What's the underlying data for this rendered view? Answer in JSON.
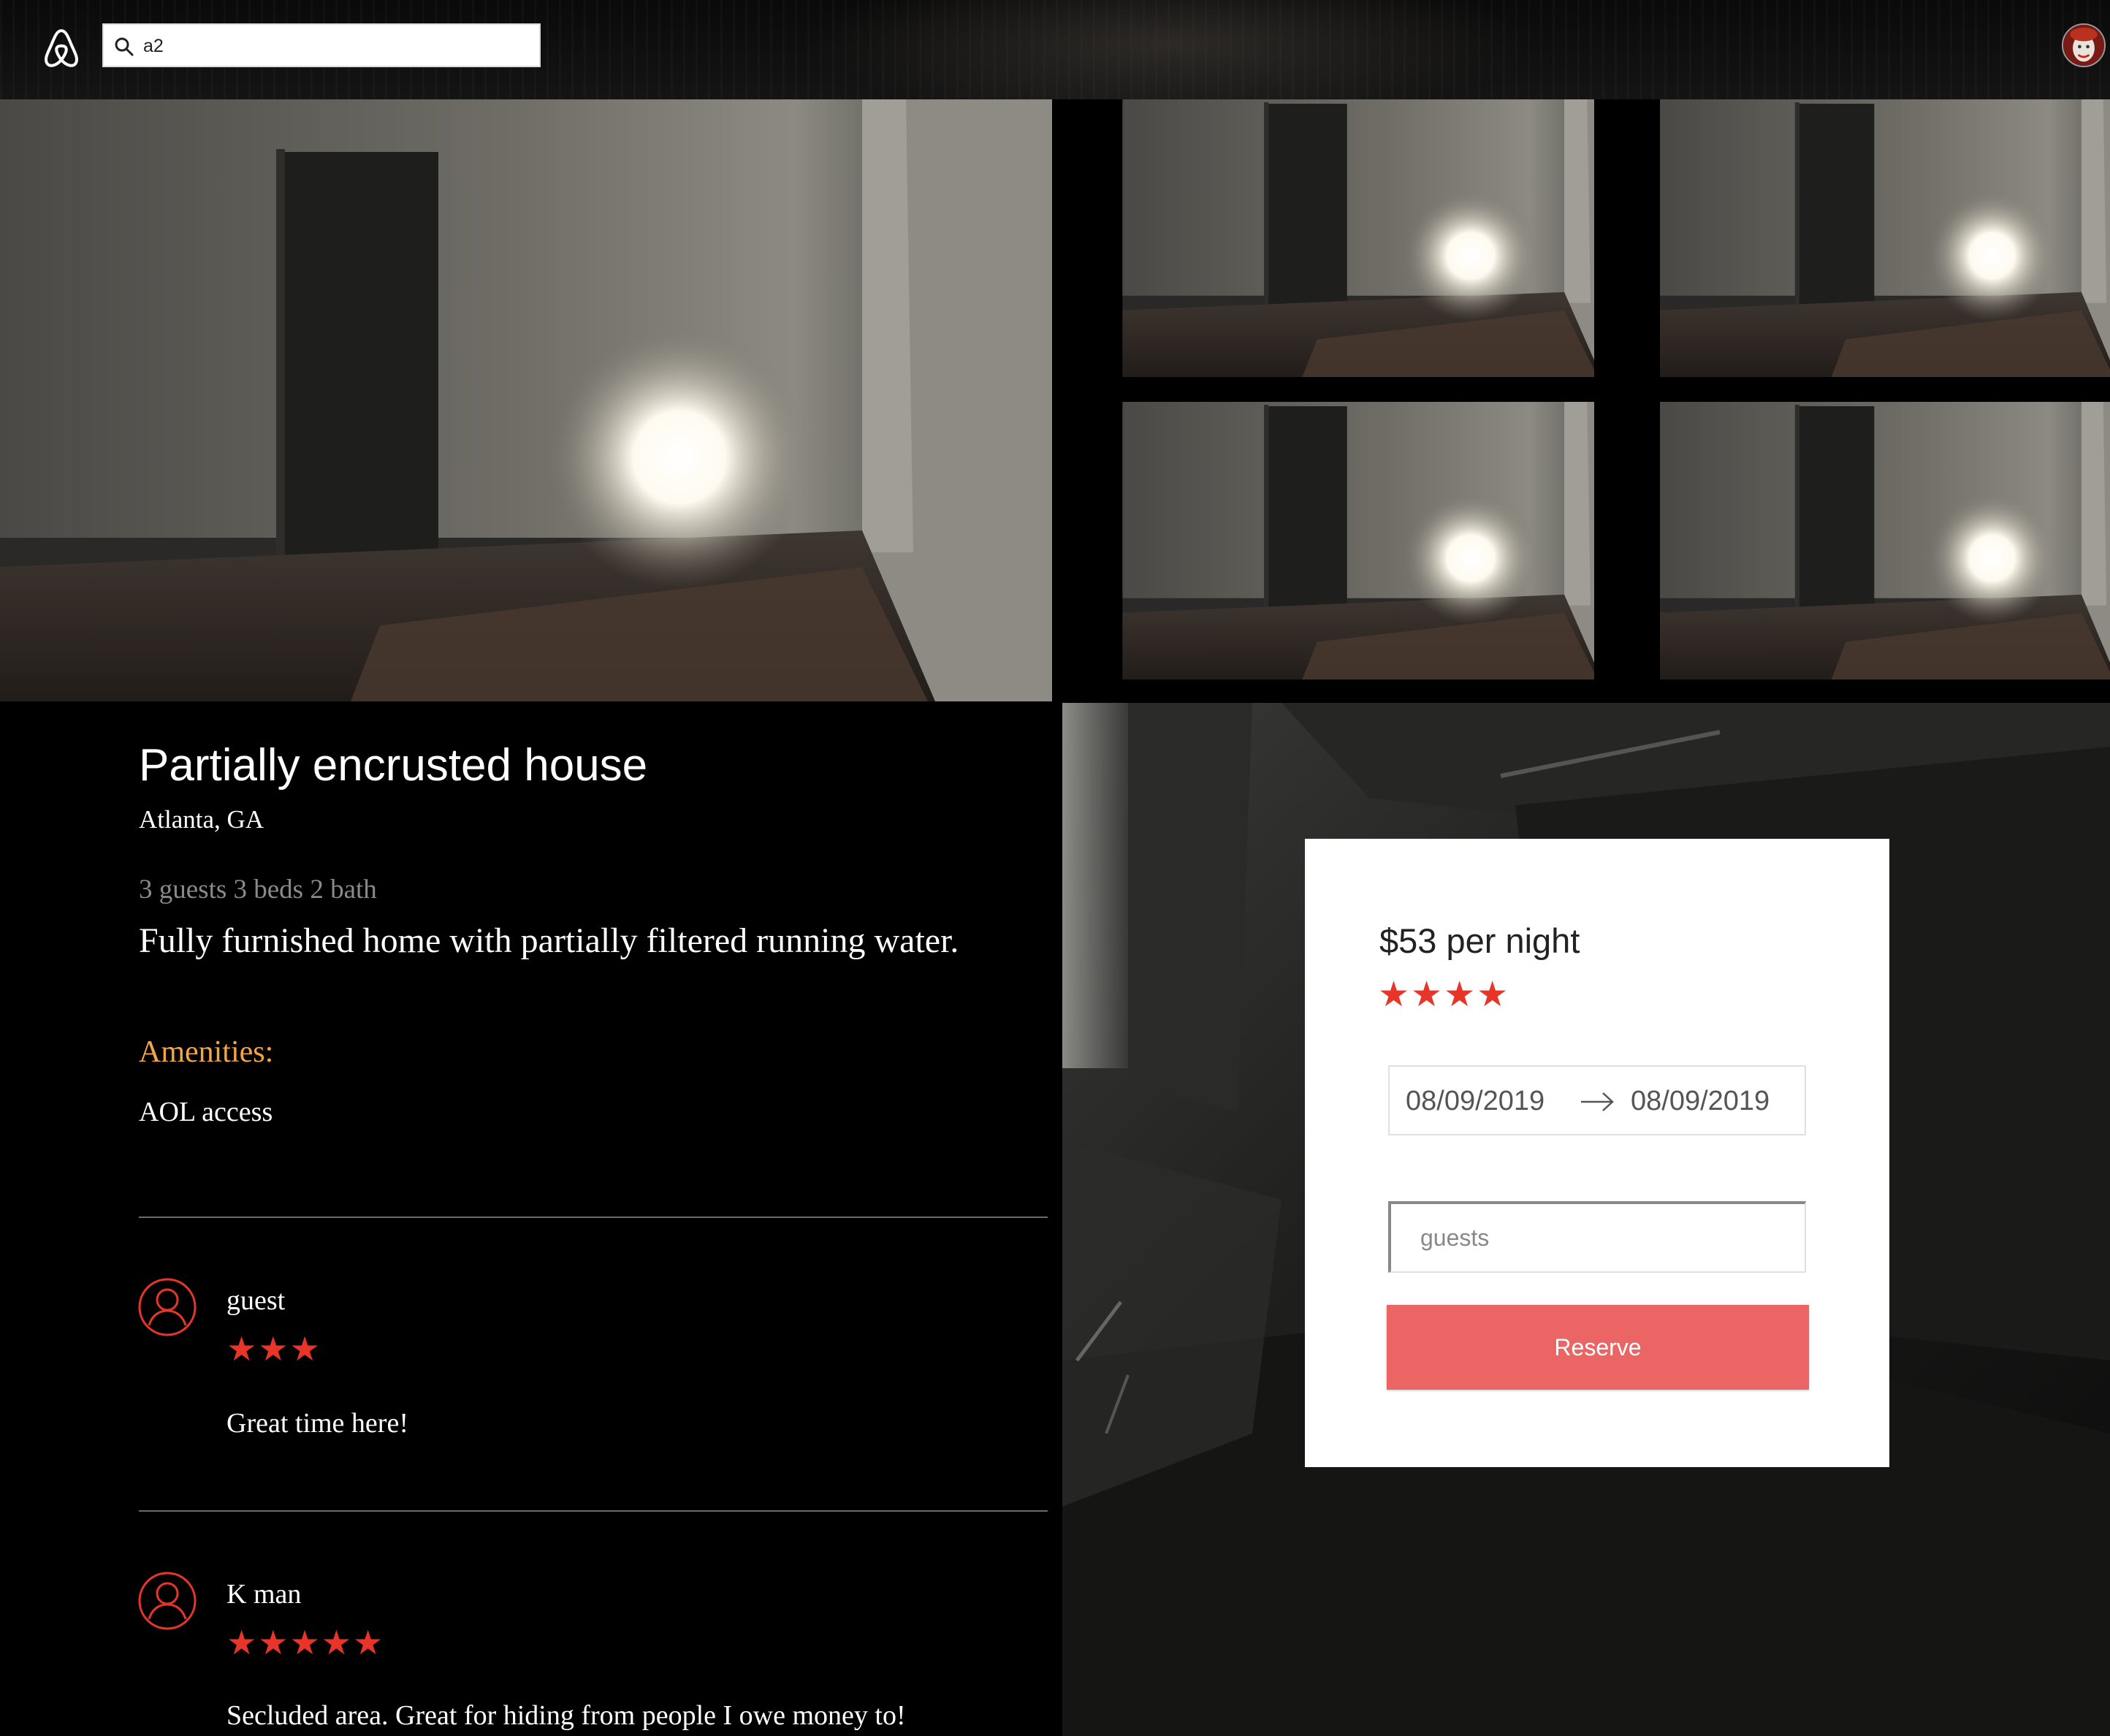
{
  "header": {
    "logo_icon": "airbnb-logo-icon",
    "search": {
      "value": "a2",
      "icon": "search-icon"
    },
    "avatar_icon": "clown-avatar"
  },
  "gallery": {
    "photos": [
      "dark-room-photo",
      "dark-room-photo",
      "dark-room-photo",
      "dark-room-photo",
      "dark-room-photo"
    ]
  },
  "listing": {
    "title": "Partially encrusted house",
    "location": "Atlanta, GA",
    "specs": "3 guests 3 beds 2 bath",
    "description": "Fully furnished home with partially filtered running water.",
    "amenities_heading": "Amenities:",
    "amenities": [
      "AOL access"
    ]
  },
  "reviews": [
    {
      "name": "guest",
      "stars": "★★★",
      "rating": 3,
      "text": "Great time here!"
    },
    {
      "name": "K man",
      "stars": "★★★★★",
      "rating": 5,
      "text": "Secluded area. Great for hiding from people I owe money to!"
    }
  ],
  "booking": {
    "price": "$53 per night",
    "stars": "★★★★",
    "rating": 4,
    "check_in": "08/09/2019",
    "check_out": "08/09/2019",
    "guests_placeholder": "guests",
    "reserve_label": "Reserve"
  },
  "colors": {
    "accent_star": "#e8352a",
    "reserve_button": "#ec6565",
    "amenities_heading": "#f5a541",
    "page_background": "#000000"
  }
}
